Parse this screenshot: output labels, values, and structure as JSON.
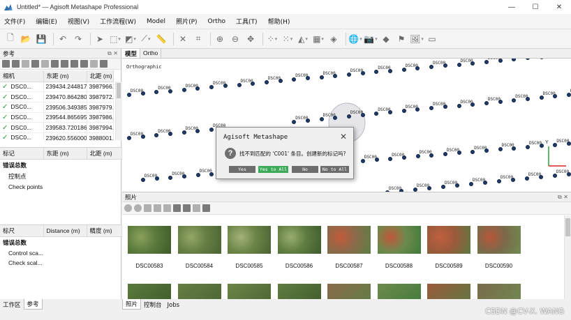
{
  "window": {
    "title": "Untitled* — Agisoft Metashape Professional",
    "minimize": "—",
    "maximize": "☐",
    "close": "✕"
  },
  "menu": [
    "文件(F)",
    "编辑(E)",
    "视图(V)",
    "工作流程(W)",
    "Model",
    "照片(P)",
    "Ortho",
    "工具(T)",
    "帮助(H)"
  ],
  "reference_panel": {
    "title": "参考",
    "cameras": {
      "headers": [
        "相机",
        "东距 (m)",
        "北距 (m)"
      ],
      "rows": [
        {
          "name": "DSC0...",
          "east": "239434.244817",
          "north": "3987966."
        },
        {
          "name": "DSC0...",
          "east": "239470.864280",
          "north": "3987972."
        },
        {
          "name": "DSC0...",
          "east": "239506.349385",
          "north": "3987979."
        },
        {
          "name": "DSC0...",
          "east": "239544.865695",
          "north": "3987986."
        },
        {
          "name": "DSC0...",
          "east": "239583.720186",
          "north": "3987994."
        },
        {
          "name": "DSC0...",
          "east": "239620.556000",
          "north": "3988001."
        }
      ]
    },
    "markers": {
      "headers": [
        "标记",
        "东距 (m)",
        "北距 (m)"
      ],
      "group": "错误总数",
      "items": [
        "控制点",
        "Check points"
      ]
    },
    "scalebars": {
      "headers": [
        "标尺",
        "Distance (m)",
        "精度 (m)"
      ],
      "group": "错误总数",
      "items": [
        "Control sca...",
        "Check scal..."
      ]
    }
  },
  "left_tabs": [
    "工作区",
    "参考"
  ],
  "model_view": {
    "tabs": [
      "模型",
      "Ortho"
    ],
    "projection": "Orthographic",
    "axis_label": "Y"
  },
  "dialog": {
    "title": "Agisoft Metashape",
    "message": "找不到匹配的 'C001' 条目。创建新的标记吗?",
    "buttons": [
      "Yes",
      "Yes to All",
      "No",
      "No to All"
    ],
    "close": "✕"
  },
  "photos_panel": {
    "title": "照片",
    "photos": [
      "DSC00583",
      "DSC00584",
      "DSC00585",
      "DSC00586",
      "DSC00587",
      "DSC00588",
      "DSC00589",
      "DSC00590"
    ]
  },
  "bottom_tabs": [
    "照片",
    "控制台",
    "Jobs"
  ],
  "watermark": "CSDN @CV-X. WANG",
  "colors": {
    "dialog_default_button": "#3daa5a",
    "camera_marker": "#1f3a68",
    "check_ok": "#2a9d3a"
  }
}
